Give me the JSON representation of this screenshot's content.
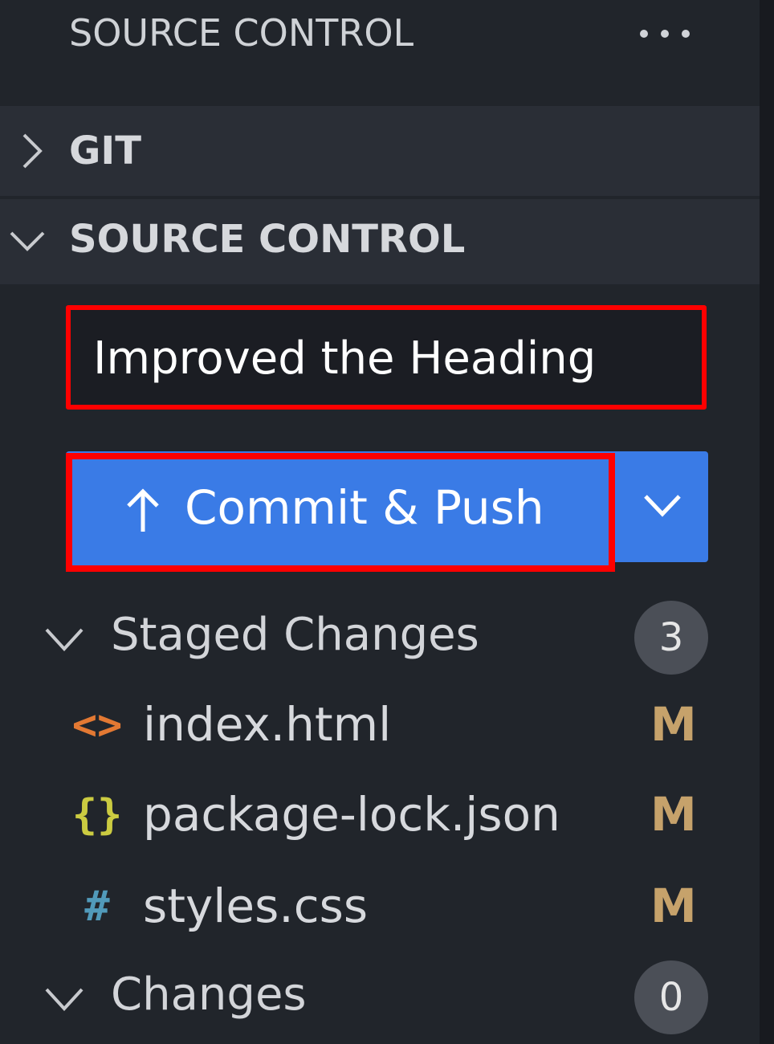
{
  "header": {
    "title": "SOURCE CONTROL",
    "more_icon": "ellipsis-icon"
  },
  "sections": {
    "git": {
      "label": "GIT",
      "expanded": false
    },
    "source_control": {
      "label": "SOURCE CONTROL",
      "expanded": true
    }
  },
  "commit": {
    "message": "Improved the Heading",
    "button_label": "Commit & Push",
    "button_icon": "arrow-up-icon",
    "dropdown_icon": "chevron-down-icon"
  },
  "staged": {
    "label": "Staged Changes",
    "count": "3",
    "files": [
      {
        "name": "index.html",
        "icon": "<>",
        "icon_name": "html-file-icon",
        "status": "M"
      },
      {
        "name": "package-lock.json",
        "icon": "{}",
        "icon_name": "json-file-icon",
        "status": "M"
      },
      {
        "name": "styles.css",
        "icon": "#",
        "icon_name": "css-file-icon",
        "status": "M"
      }
    ]
  },
  "changes": {
    "label": "Changes",
    "count": "0"
  },
  "colors": {
    "accent": "#3a7be6",
    "highlight": "#ff0000",
    "modified": "#c6a26b",
    "html": "#e37933",
    "json": "#cbcb41",
    "css": "#519aba"
  }
}
